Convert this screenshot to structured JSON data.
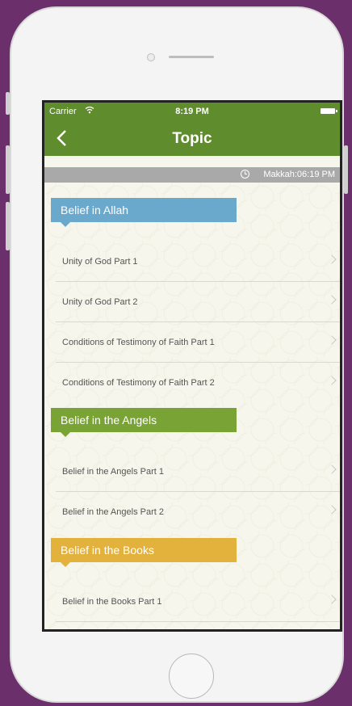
{
  "status_bar": {
    "carrier": "Carrier",
    "time": "8:19 PM"
  },
  "nav": {
    "title": "Topic"
  },
  "prayer": {
    "text": "Makkah:06:19 PM"
  },
  "sections": [
    {
      "title": "Belief in Allah",
      "color": "#6aa8cc",
      "items": [
        "Unity of God Part 1",
        "Unity of God Part 2",
        "Conditions of Testimony of Faith Part 1",
        "Conditions of Testimony of Faith Part 2"
      ]
    },
    {
      "title": "Belief in the Angels",
      "color": "#7aa335",
      "items": [
        "Belief in the Angels Part 1",
        "Belief in the Angels Part 2"
      ]
    },
    {
      "title": "Belief in the Books",
      "color": "#e3b23c",
      "items": [
        "Belief in the Books Part 1"
      ]
    }
  ],
  "colors": {
    "brand_green": "#5f8c2c",
    "frame_purple": "#6b2f6b"
  }
}
